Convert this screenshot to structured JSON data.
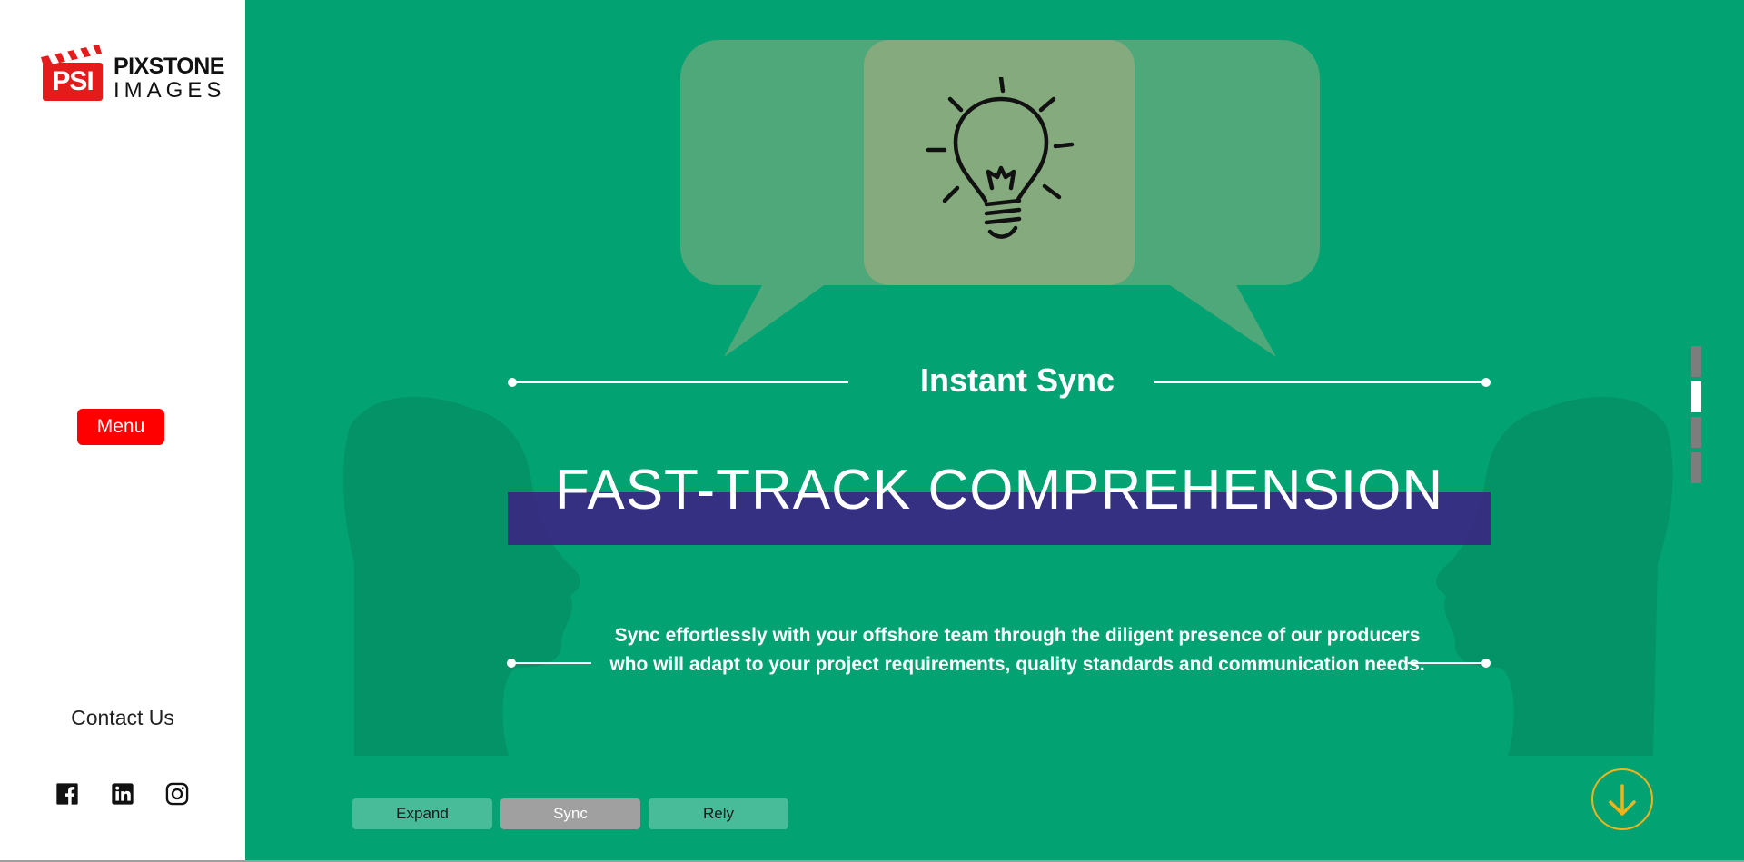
{
  "brand": {
    "logo_badge": "PSI",
    "logo_line1": "PIXSTONE",
    "logo_line2": "IMAGES"
  },
  "sidebar": {
    "menu_label": "Menu",
    "contact_label": "Contact Us",
    "social_icons": [
      "facebook-icon",
      "linkedin-icon",
      "instagram-icon"
    ]
  },
  "hero": {
    "subtitle": "Instant Sync",
    "headline": "FAST-TRACK COMPREHENSION",
    "body": "Sync effortlessly with your offshore team through the diligent presence of our producers who will adapt to your project requirements, quality standards and communication needs."
  },
  "tabs": [
    {
      "label": "Expand",
      "active": false
    },
    {
      "label": "Sync",
      "active": true
    },
    {
      "label": "Rely",
      "active": false
    }
  ],
  "scroll_indicator": {
    "count": 4,
    "active_index": 1
  },
  "colors": {
    "background": "#02a272",
    "accent_red": "#ff0000",
    "headline_band": "#3a2682",
    "arrow_circle": "#f1b51b",
    "bubble": "#4da97a",
    "bulb_square": "#85aa7e"
  }
}
